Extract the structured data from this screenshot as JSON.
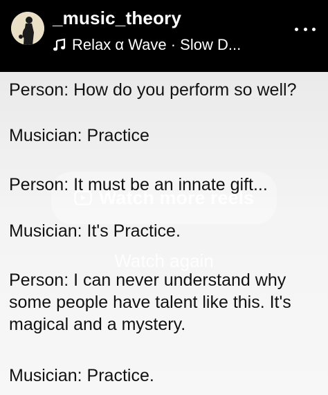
{
  "header": {
    "username": "_music_theory",
    "audio_label": "Relax α Wave · Slow D...",
    "avatar_icon": "saxophone-player-avatar",
    "audio_icon": "music-note-icon",
    "more_icon": "more-options-icon"
  },
  "overlay": {
    "watch_more_label": "Watch more reels",
    "watch_again_label": "Watch again"
  },
  "dialogue": [
    "Person: How do you perform so well?",
    "Musician: Practice",
    "Person: It must be an innate gift...",
    "Musician: It's Practice.",
    "Person: I can never understand why some people have talent like this. It's magical and a mystery.",
    "Musician: Practice."
  ],
  "colors": {
    "header_bg": "#000000",
    "header_text": "#ffffff",
    "body_text": "#111111",
    "avatar_bg": "#e8dfc6"
  }
}
